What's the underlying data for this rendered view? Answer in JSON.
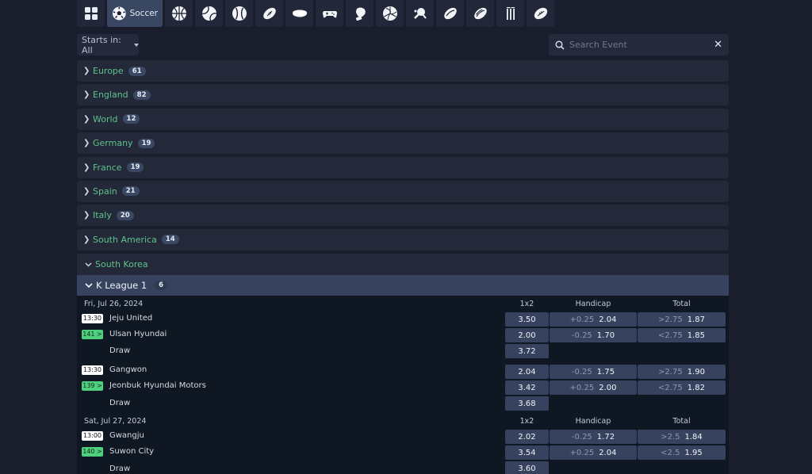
{
  "sports_bar": {
    "tabs": [
      {
        "icon": "grid-icon",
        "label": null,
        "active": false
      },
      {
        "icon": "soccer-ball-icon",
        "label": "Soccer",
        "active": true
      },
      {
        "icon": "basketball-icon",
        "label": null,
        "active": false
      },
      {
        "icon": "tennis-ball-icon",
        "label": null,
        "active": false
      },
      {
        "icon": "baseball-icon",
        "label": null,
        "active": false
      },
      {
        "icon": "american-football-icon",
        "label": null,
        "active": false
      },
      {
        "icon": "hockey-puck-icon",
        "label": null,
        "active": false
      },
      {
        "icon": "gamepad-icon",
        "label": null,
        "active": false
      },
      {
        "icon": "boxing-glove-icon",
        "label": null,
        "active": false
      },
      {
        "icon": "volleyball-icon",
        "label": null,
        "active": false
      },
      {
        "icon": "table-tennis-icon",
        "label": null,
        "active": false
      },
      {
        "icon": "rugby-league-icon",
        "label": null,
        "active": false
      },
      {
        "icon": "rugby-union-icon",
        "label": null,
        "active": false
      },
      {
        "icon": "cricket-icon",
        "label": null,
        "active": false
      },
      {
        "icon": "aussie-rules-icon",
        "label": null,
        "active": false
      }
    ]
  },
  "filter": {
    "label": "Starts in: All"
  },
  "search": {
    "placeholder": "Search Event",
    "value": ""
  },
  "categories": [
    {
      "name": "Europe",
      "count": "61"
    },
    {
      "name": "England",
      "count": "82"
    },
    {
      "name": "World",
      "count": "12"
    },
    {
      "name": "Germany",
      "count": "19"
    },
    {
      "name": "France",
      "count": "19"
    },
    {
      "name": "Spain",
      "count": "21"
    },
    {
      "name": "Italy",
      "count": "20"
    },
    {
      "name": "South America",
      "count": "14"
    }
  ],
  "expanded_category": {
    "name": "South Korea",
    "league": {
      "name": "K League 1",
      "count": "6"
    }
  },
  "columns": {
    "c1": "1x2",
    "c2": "Handicap",
    "c3": "Total"
  },
  "days": [
    {
      "date": "Fri, Jul 26, 2024",
      "matches": [
        {
          "time": "13:30",
          "more": "141 >",
          "home": "Jeju United",
          "away": "Ulsan Hyundai",
          "draw_label": "Draw",
          "odds_1x2": [
            "3.50",
            "2.00",
            "3.72"
          ],
          "handicap": [
            {
              "line": "+0.25",
              "odd": "2.04"
            },
            {
              "line": "-0.25",
              "odd": "1.70"
            }
          ],
          "total": [
            {
              "line": ">2.75",
              "odd": "1.87"
            },
            {
              "line": "<2.75",
              "odd": "1.85"
            }
          ]
        },
        {
          "time": "13:30",
          "more": "139 >",
          "home": "Gangwon",
          "away": "Jeonbuk Hyundai Motors",
          "draw_label": "Draw",
          "odds_1x2": [
            "2.04",
            "3.42",
            "3.68"
          ],
          "handicap": [
            {
              "line": "-0.25",
              "odd": "1.75"
            },
            {
              "line": "+0.25",
              "odd": "2.00"
            }
          ],
          "total": [
            {
              "line": ">2.75",
              "odd": "1.90"
            },
            {
              "line": "<2.75",
              "odd": "1.82"
            }
          ]
        }
      ]
    },
    {
      "date": "Sat, Jul 27, 2024",
      "matches": [
        {
          "time": "13:00",
          "more": "140 >",
          "home": "Gwangju",
          "away": "Suwon City",
          "draw_label": "Draw",
          "odds_1x2": [
            "2.02",
            "3.54",
            "3.60"
          ],
          "handicap": [
            {
              "line": "-0.25",
              "odd": "1.72"
            },
            {
              "line": "+0.25",
              "odd": "2.04"
            }
          ],
          "total": [
            {
              "line": ">2.5",
              "odd": "1.84"
            },
            {
              "line": "<2.5",
              "odd": "1.95"
            }
          ]
        }
      ]
    }
  ],
  "colors": {
    "accent_green": "#5fc28a",
    "live_badge": "#4fd07f",
    "odd_button": "#37435e",
    "active_tab": "#3a4763"
  }
}
